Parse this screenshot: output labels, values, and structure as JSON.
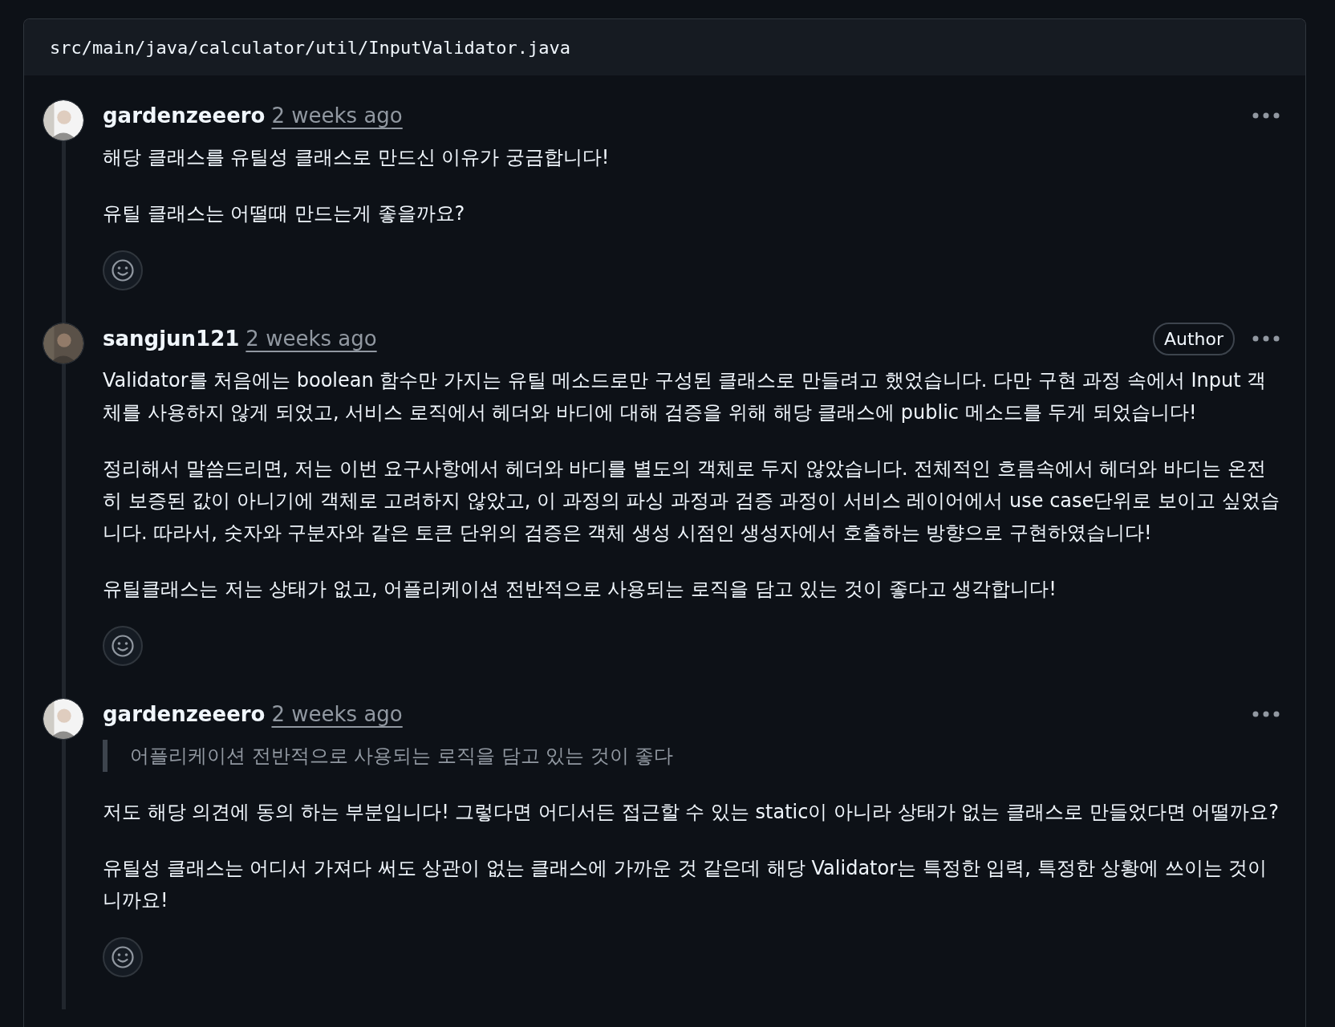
{
  "file_path": "src/main/java/calculator/util/InputValidator.java",
  "comments": [
    {
      "author": "gardenzeeero",
      "avatar": {
        "kind": "picture",
        "color": "#f4f4f4"
      },
      "time": "2 weeks ago",
      "blocks": [
        {
          "kind": "paragraph",
          "text": "해당 클래스를 유틸성 클래스로 만드신 이유가 궁금합니다!"
        },
        {
          "kind": "paragraph",
          "text": "유틸 클래스는 어떨때 만드는게 좋을까요?"
        }
      ]
    },
    {
      "author": "sangjun121",
      "avatar": {
        "kind": "picture",
        "color": "#5a5148"
      },
      "time": "2 weeks ago",
      "badge": "Author",
      "blocks": [
        {
          "kind": "paragraph",
          "text": "Validator를 처음에는 boolean 함수만 가지는 유틸 메소드로만 구성된 클래스로 만들려고 했었습니다. 다만 구현 과정 속에서 Input 객체를 사용하지 않게 되었고, 서비스 로직에서 헤더와 바디에 대해 검증을 위해 해당 클래스에 public 메소드를 두게 되었습니다!"
        },
        {
          "kind": "paragraph",
          "text": "정리해서 말씀드리면, 저는 이번 요구사항에서 헤더와 바디를 별도의 객체로 두지 않았습니다. 전체적인 흐름속에서 헤더와 바디는 온전히 보증된 값이 아니기에 객체로 고려하지 않았고, 이 과정의 파싱 과정과 검증 과정이 서비스 레이어에서 use case단위로 보이고 싶었습니다. 따라서, 숫자와 구분자와 같은 토큰 단위의 검증은 객체 생성 시점인 생성자에서 호출하는 방향으로 구현하였습니다!"
        },
        {
          "kind": "paragraph",
          "text": "유틸클래스는 저는 상태가 없고, 어플리케이션 전반적으로 사용되는 로직을 담고 있는 것이 좋다고 생각합니다!"
        }
      ]
    },
    {
      "author": "gardenzeeero",
      "avatar": {
        "kind": "picture",
        "color": "#f4f4f4"
      },
      "time": "2 weeks ago",
      "blocks": [
        {
          "kind": "quote",
          "text": "어플리케이션 전반적으로 사용되는 로직을 담고 있는 것이 좋다"
        },
        {
          "kind": "paragraph",
          "text": "저도 해당 의견에 동의 하는 부분입니다! 그렇다면 어디서든 접근할 수 있는 static이 아니라 상태가 없는 클래스로 만들었다면 어떨까요?"
        },
        {
          "kind": "paragraph",
          "text": "유틸성 클래스는 어디서 가져다 써도 상관이 없는 클래스에 가까운 것 같은데 해당 Validator는 특정한 입력, 특정한 상황에 쓰이는 것이니까요!"
        }
      ]
    }
  ]
}
